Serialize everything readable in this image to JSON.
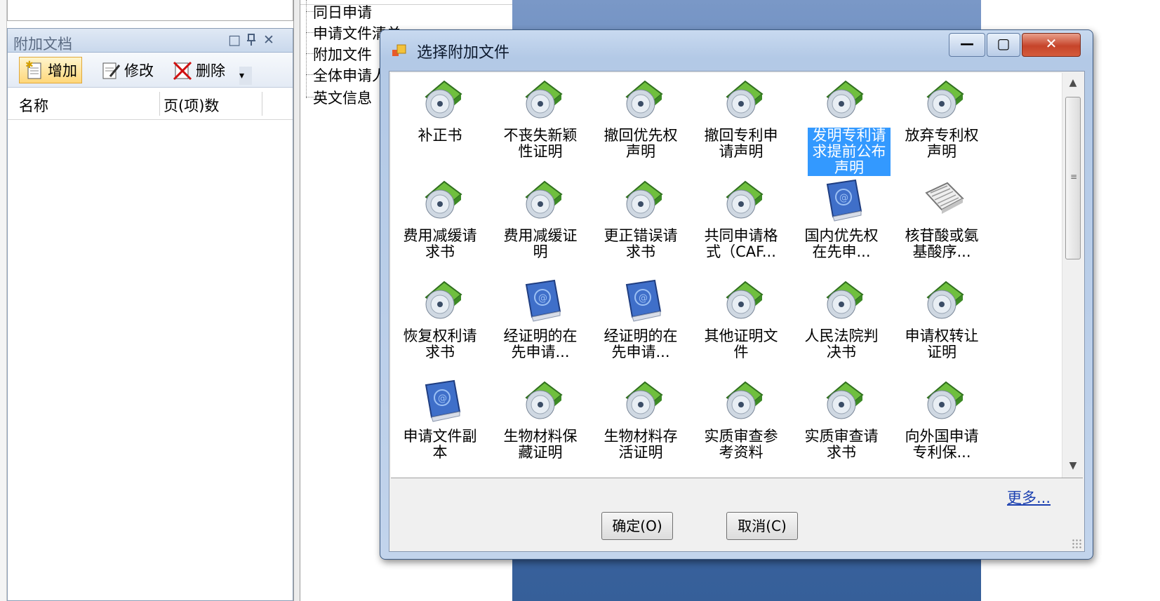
{
  "left_panel": {
    "title": "附加文档",
    "controls": [
      "□",
      "ᵾ",
      "✕"
    ],
    "toolbar": {
      "add": "增加",
      "edit": "修改",
      "delete": "删除",
      "overflow": "▾"
    },
    "columns": [
      "名称",
      "页(项)数"
    ]
  },
  "tree": {
    "items": [
      "同日申请",
      "申请文件清单",
      "附加文件",
      "全体申请人",
      "英文信息"
    ]
  },
  "dialog": {
    "title": "选择附加文件",
    "window_buttons": {
      "minimize": "—",
      "maximize": "▢",
      "close": "✕"
    },
    "selected_item": "发明专利请求提前公布声明",
    "items": [
      {
        "label": "补正书",
        "icon": "cd-icon"
      },
      {
        "label": "不丧失新颖\n性证明",
        "icon": "cd-icon"
      },
      {
        "label": "撤回优先权\n声明",
        "icon": "cd-icon"
      },
      {
        "label": "撤回专利申\n请声明",
        "icon": "cd-icon"
      },
      {
        "label": "发明专利请\n求提前公布\n声明",
        "icon": "cd-icon"
      },
      {
        "label": "放弃专利权\n声明",
        "icon": "cd-icon"
      },
      {
        "label": "费用减缓请\n求书",
        "icon": "cd-icon"
      },
      {
        "label": "费用减缓证\n明",
        "icon": "cd-icon"
      },
      {
        "label": "更正错误请\n求书",
        "icon": "cd-icon"
      },
      {
        "label": "共同申请格\n式（CAF...",
        "icon": "cd-icon"
      },
      {
        "label": "国内优先权\n在先申...",
        "icon": "book-icon"
      },
      {
        "label": "核苷酸或氨\n基酸序...",
        "icon": "document-icon"
      },
      {
        "label": "恢复权利请\n求书",
        "icon": "cd-icon"
      },
      {
        "label": "经证明的在\n先申请...",
        "icon": "book-icon"
      },
      {
        "label": "经证明的在\n先申请...",
        "icon": "book-icon"
      },
      {
        "label": "其他证明文\n件",
        "icon": "cd-icon"
      },
      {
        "label": "人民法院判\n决书",
        "icon": "cd-icon"
      },
      {
        "label": "申请权转让\n证明",
        "icon": "cd-icon"
      },
      {
        "label": "申请文件副\n本",
        "icon": "book-icon"
      },
      {
        "label": "生物材料保\n藏证明",
        "icon": "cd-icon"
      },
      {
        "label": "生物材料存\n活证明",
        "icon": "cd-icon"
      },
      {
        "label": "实质审查参\n考资料",
        "icon": "cd-icon"
      },
      {
        "label": "实质审查请\n求书",
        "icon": "cd-icon"
      },
      {
        "label": "向外国申请\n专利保...",
        "icon": "cd-icon"
      }
    ],
    "more_link": "更多...",
    "ok_button": "确定(O)",
    "cancel_button": "取消(C)"
  }
}
